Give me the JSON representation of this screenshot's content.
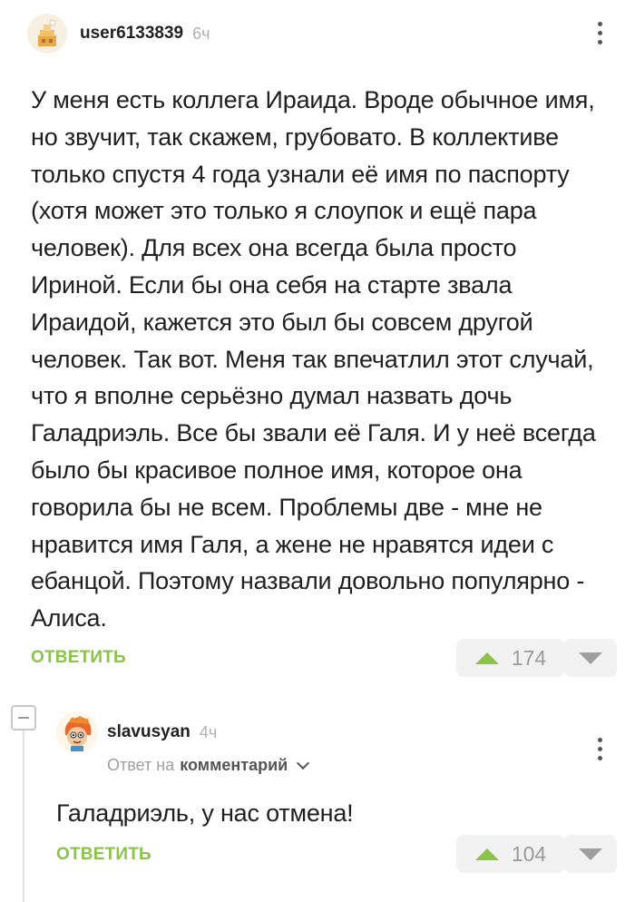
{
  "comment": {
    "username": "user6133839",
    "time": "6ч",
    "text": "У меня есть коллега Ираида. Вроде обычное имя, но звучит, так скажем, грубовато. В коллективе только спустя 4 года узнали её имя по паспорту (хотя может это только я слоупок и ещё пара человек). Для всех она всегда была просто Ириной. Если бы она себя на старте звала Ираидой, кажется это был бы совсем другой человек. Так вот. Меня так впечатлил этот случай, что я вполне серьёзно думал назвать дочь Галадриэль. Все бы звали её Галя. И у неё всегда было бы красивое полное имя, которое она говорила бы не всем. Проблемы две - мне не нравится имя Галя, а жене не нравятся идеи с ебанцой. Поэтому назвали довольно популярно - Алиса.",
    "reply_label": "ОТВЕТИТЬ",
    "rating": "174"
  },
  "reply": {
    "username": "slavusyan",
    "time": "4ч",
    "reply_prefix": "Ответ на",
    "reply_target": "комментарий",
    "text": "Галадриэль, у нас отмена!",
    "reply_label": "ОТВЕТИТЬ",
    "rating": "104"
  },
  "colors": {
    "accent_green": "#8bc34a",
    "muted_gray": "#9e9e9e"
  },
  "icons": [
    "kebab-menu-icon",
    "upvote-arrow-icon",
    "downvote-arrow-icon",
    "collapse-thread-icon",
    "chevron-down-icon"
  ]
}
